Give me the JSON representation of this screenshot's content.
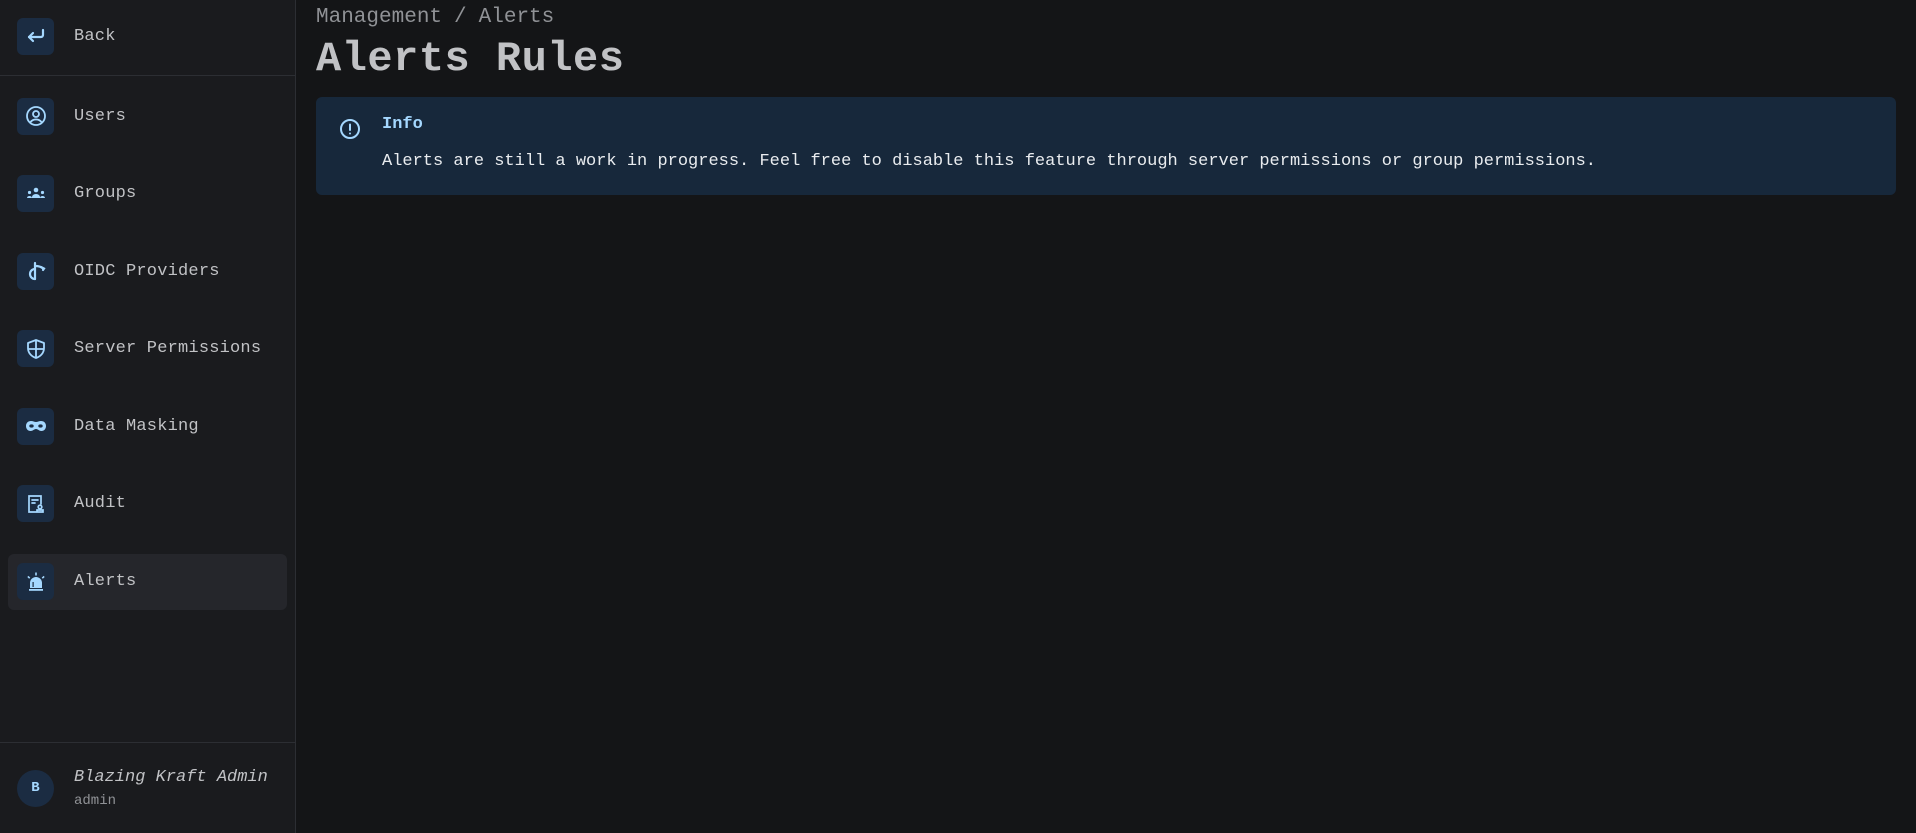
{
  "sidebar": {
    "back": {
      "label": "Back",
      "icon": "back-arrow-icon"
    },
    "items": [
      {
        "label": "Users",
        "icon": "user-circle-icon",
        "active": false
      },
      {
        "label": "Groups",
        "icon": "users-group-icon",
        "active": false
      },
      {
        "label": "OIDC Providers",
        "icon": "openid-icon",
        "active": false
      },
      {
        "label": "Server Permissions",
        "icon": "shield-icon",
        "active": false
      },
      {
        "label": "Data Masking",
        "icon": "mask-icon",
        "active": false
      },
      {
        "label": "Audit",
        "icon": "certificate-icon",
        "active": false
      },
      {
        "label": "Alerts",
        "icon": "alarm-light-icon",
        "active": true
      }
    ],
    "user": {
      "avatar_initial": "B",
      "name": "Blazing Kraft Admin",
      "role": "admin"
    }
  },
  "main": {
    "breadcrumb": [
      "Management",
      "Alerts"
    ],
    "breadcrumb_separator": "/",
    "title": "Alerts Rules",
    "alert": {
      "icon": "info-circle-icon",
      "title": "Info",
      "message": "Alerts are still a work in progress. Feel free to disable this feature through server permissions or group permissions."
    }
  },
  "colors": {
    "accent": "#a5d8ff",
    "icon_bg": "#1b2c42",
    "alert_bg": "#17283b",
    "sidebar_bg": "#1a1b1e",
    "page_bg": "#141517",
    "active_item_bg": "#25262b"
  }
}
